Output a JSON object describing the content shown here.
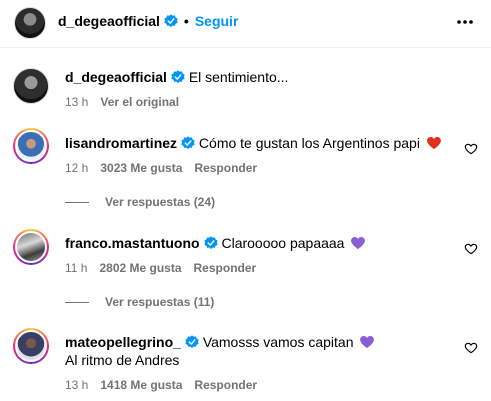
{
  "header": {
    "username": "d_degeaofficial",
    "separator": "•",
    "follow_label": "Seguir"
  },
  "caption": {
    "username": "d_degeaofficial",
    "text": "El sentimiento...",
    "time": "13 h",
    "see_original": "Ver el original"
  },
  "comments": [
    {
      "username": "lisandromartinez",
      "text": "Cómo te gustan los Argentinos papi",
      "emoji": "red-heart",
      "time": "12 h",
      "likes": "3023 Me gusta",
      "reply": "Responder",
      "view_replies": "Ver respuestas (24)"
    },
    {
      "username": "franco.mastantuono",
      "text": "Clarooooo papaaaa",
      "emoji": "purple-heart",
      "time": "11 h",
      "likes": "2802 Me gusta",
      "reply": "Responder",
      "view_replies": "Ver respuestas (11)"
    },
    {
      "username": "mateopellegrino_",
      "text": "Vamosss vamos capitan",
      "emoji": "purple-heart",
      "text_line2": "Al ritmo de Andres",
      "time": "13 h",
      "likes": "1418 Me gusta",
      "reply": "Responder"
    }
  ],
  "colors": {
    "accent": "#0095f6",
    "verified": "#0095f6",
    "muted": "#737373",
    "red_heart": "#e0301e",
    "purple_heart": "#8a5cd6"
  }
}
